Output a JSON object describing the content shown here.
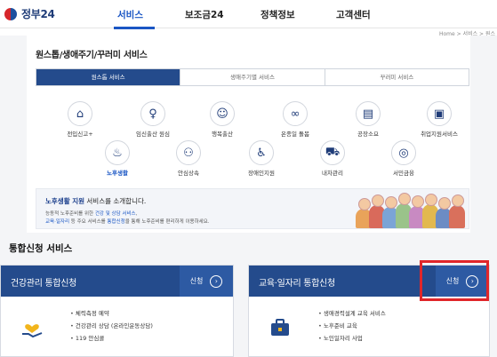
{
  "header": {
    "logo_text": "정부24",
    "nav": [
      "서비스",
      "보조금24",
      "정책정보",
      "고객센터"
    ],
    "active_nav": "서비스",
    "breadcrumb": "Home > 서비스 > 원스"
  },
  "lifecycle": {
    "title": "원스톱/생애주기/꾸러미 서비스",
    "tabs": [
      "원스톱 서비스",
      "생애주기별 서비스",
      "꾸러미 서비스"
    ],
    "items_row1": [
      {
        "label": "전입신고+",
        "icon": "house-icon"
      },
      {
        "label": "임신출산 원심",
        "icon": "pregnancy-icon"
      },
      {
        "label": "행복출산",
        "icon": "baby-icon"
      },
      {
        "label": "온종일 돌봄",
        "icon": "ribbon-icon"
      },
      {
        "label": "공장소요",
        "icon": "book-icon"
      },
      {
        "label": "취업지원서비스",
        "icon": "briefcase-icon"
      }
    ],
    "items_row2": [
      {
        "label": "노후생활",
        "icon": "elderly-icon"
      },
      {
        "label": "안심상속",
        "icon": "family-icon"
      },
      {
        "label": "장애인지원",
        "icon": "wheelchair-icon"
      },
      {
        "label": "내차관리",
        "icon": "car-icon"
      },
      {
        "label": "서민금융",
        "icon": "coins-icon"
      }
    ],
    "selected": "노후생활"
  },
  "banner": {
    "title_bold": "노후생활 지원",
    "title_rest": " 서비스를 소개합니다.",
    "line1_pre": "능동적 노후준비를 위한 ",
    "line1_hl": "건강 및 상담 서비스",
    "line1_post": ",",
    "line2_hl1": "교육·일자리",
    "line2_mid": " 등 주요 서비스를 ",
    "line2_hl2": "통합신청",
    "line2_post": "을 통해 노후준비를 편리하게 이용하세요."
  },
  "integrated": {
    "title": "통합신청 서비스",
    "boxes": [
      {
        "title": "건강관리 통합신청",
        "apply_label": "신청",
        "icon": "heart-hand-icon",
        "items": [
          "체력측정 예약",
          "건강관리 상담 (온라인운동상담)",
          "119 안심콜"
        ]
      },
      {
        "title": "교육·일자리 통합신청",
        "apply_label": "신청",
        "icon": "briefcase-icon",
        "items": [
          "생애경력설계 교육 서비스",
          "노후준비 교육",
          "노인일자리 사업"
        ]
      }
    ]
  },
  "colors": {
    "primary": "#244b8c",
    "accent": "#1a56c4",
    "highlight_box": "#e0262a"
  }
}
